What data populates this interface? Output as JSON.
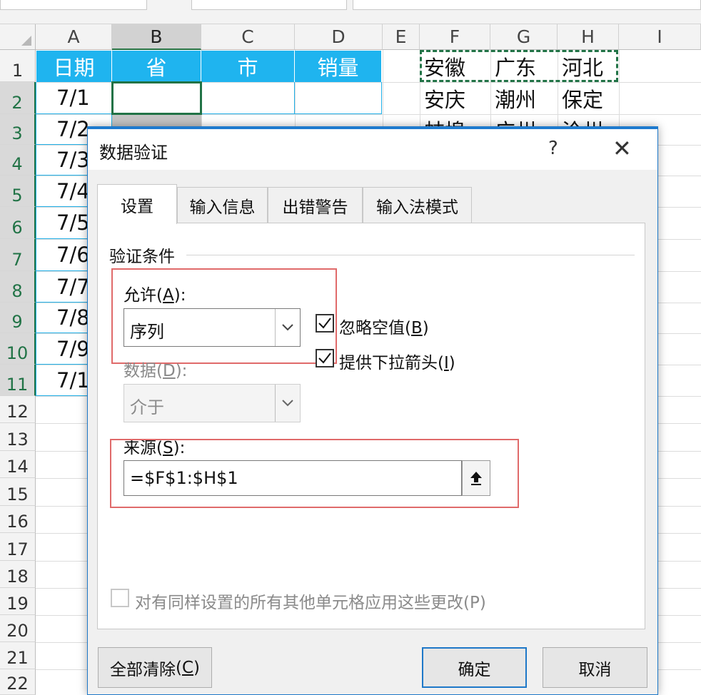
{
  "sheet": {
    "columns": [
      "A",
      "B",
      "C",
      "D",
      "E",
      "F",
      "G",
      "H",
      "I"
    ],
    "selected_column": "B",
    "rows": [
      "1",
      "2",
      "3",
      "4",
      "5",
      "6",
      "7",
      "8",
      "9",
      "10",
      "11",
      "12",
      "13",
      "14",
      "15",
      "16",
      "17",
      "18",
      "19",
      "20",
      "21",
      "22"
    ],
    "header_row": [
      "日期",
      "省",
      "市",
      "销量"
    ],
    "dates": [
      "7/1",
      "7/2",
      "7/3",
      "7/4",
      "7/5",
      "7/6",
      "7/7",
      "7/8",
      "7/9",
      "7/1"
    ],
    "province_table": {
      "row1": [
        "安徽",
        "广东",
        "河北"
      ],
      "row2": [
        "安庆",
        "潮州",
        "保定"
      ],
      "row3": [
        "蚌埠",
        "广州",
        "沧州"
      ]
    }
  },
  "dialog": {
    "title": "数据验证",
    "help": "?",
    "close": "✕",
    "tabs": [
      "设置",
      "输入信息",
      "出错警告",
      "输入法模式"
    ],
    "active_tab": "设置",
    "group_label": "验证条件",
    "allow_label": "允许",
    "allow_key": "A",
    "allow_value": "序列",
    "data_label": "数据",
    "data_key": "D",
    "data_value": "介于",
    "ignore_blank_label": "忽略空值",
    "ignore_blank_key": "B",
    "ignore_blank_checked": true,
    "in_cell_dropdown_label": "提供下拉箭头",
    "in_cell_dropdown_key": "I",
    "in_cell_dropdown_checked": true,
    "source_label": "来源",
    "source_key": "S",
    "source_value": "=$F$1:$H$1",
    "apply_all_label": "对有同样设置的所有其他单元格应用这些更改(P)",
    "apply_all_checked": false,
    "clear_all_label": "全部清除",
    "clear_all_key": "C",
    "ok_label": "确定",
    "cancel_label": "取消",
    "check_mark": "✓",
    "dropdown_icon": "chevron-down",
    "collapse_icon": "collapse-dialog-arrow",
    "accent_color": "#1e78c8",
    "highlight_color": "#e06a6a",
    "header_fill": "#1fb4ef"
  }
}
